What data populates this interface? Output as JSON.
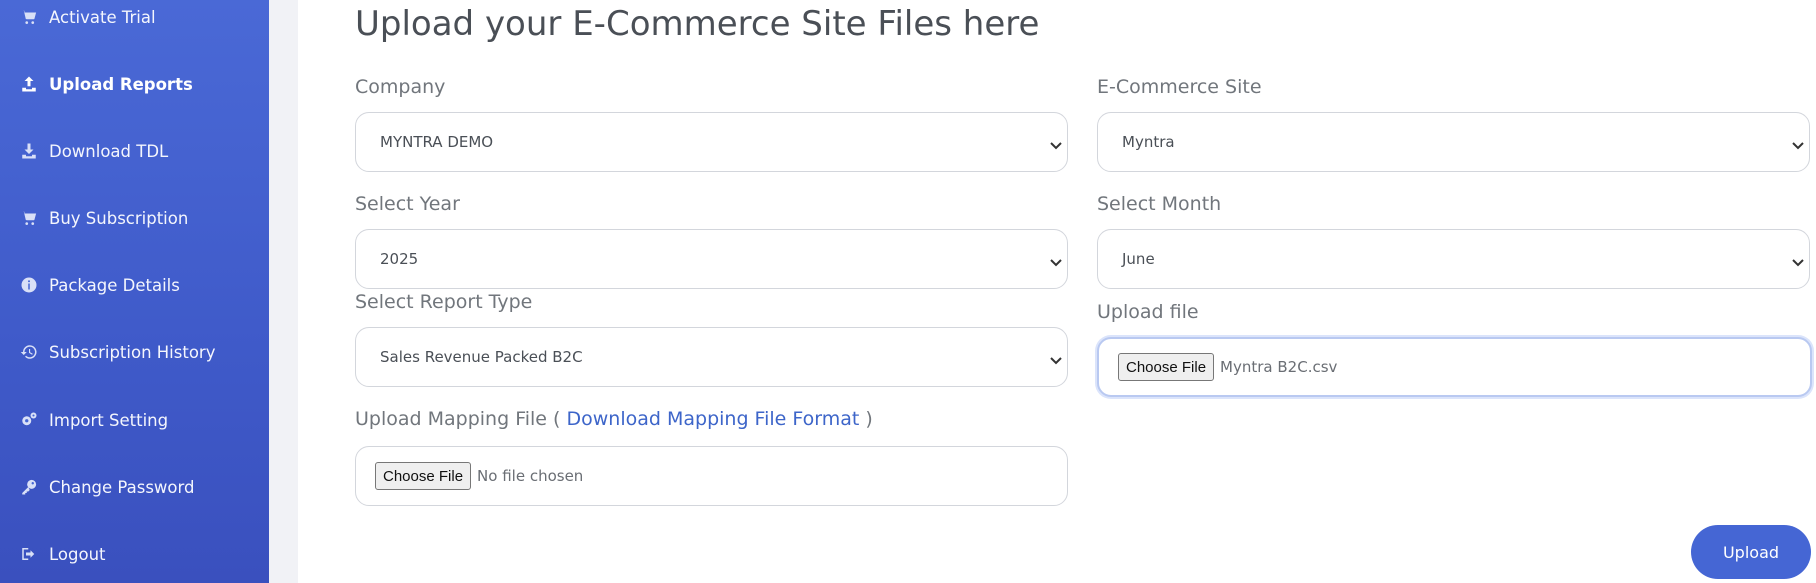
{
  "sidebar": {
    "items": [
      {
        "label": "Activate Trial",
        "icon": "cart-icon"
      },
      {
        "label": "Upload Reports",
        "icon": "upload-icon",
        "active": true
      },
      {
        "label": "Download TDL",
        "icon": "download-icon"
      },
      {
        "label": "Buy Subscription",
        "icon": "cart-icon"
      },
      {
        "label": "Package Details",
        "icon": "info-icon"
      },
      {
        "label": "Subscription History",
        "icon": "history-icon"
      },
      {
        "label": "Import Setting",
        "icon": "gears-icon"
      },
      {
        "label": "Change Password",
        "icon": "key-icon"
      },
      {
        "label": "Logout",
        "icon": "logout-icon"
      }
    ]
  },
  "main": {
    "title": "Upload your E-Commerce Site Files here",
    "company": {
      "label": "Company",
      "value": "MYNTRA DEMO"
    },
    "site": {
      "label": "E-Commerce Site",
      "value": "Myntra"
    },
    "year": {
      "label": "Select Year",
      "value": "2025"
    },
    "month": {
      "label": "Select Month",
      "value": "June"
    },
    "report_type": {
      "label": "Select Report Type",
      "value": "Sales Revenue Packed B2C"
    },
    "upload_file": {
      "label": "Upload file",
      "button": "Choose File",
      "file_name": "Myntra B2C.csv"
    },
    "mapping_file": {
      "label_prefix": "Upload Mapping File (",
      "link": "Download Mapping File Format",
      "label_suffix": ")",
      "button": "Choose File",
      "file_name": "No file chosen"
    },
    "upload_button": "Upload"
  },
  "colors": {
    "sidebar": "#4a69d6",
    "accent": "#4566d4",
    "link": "#3d65c9"
  }
}
